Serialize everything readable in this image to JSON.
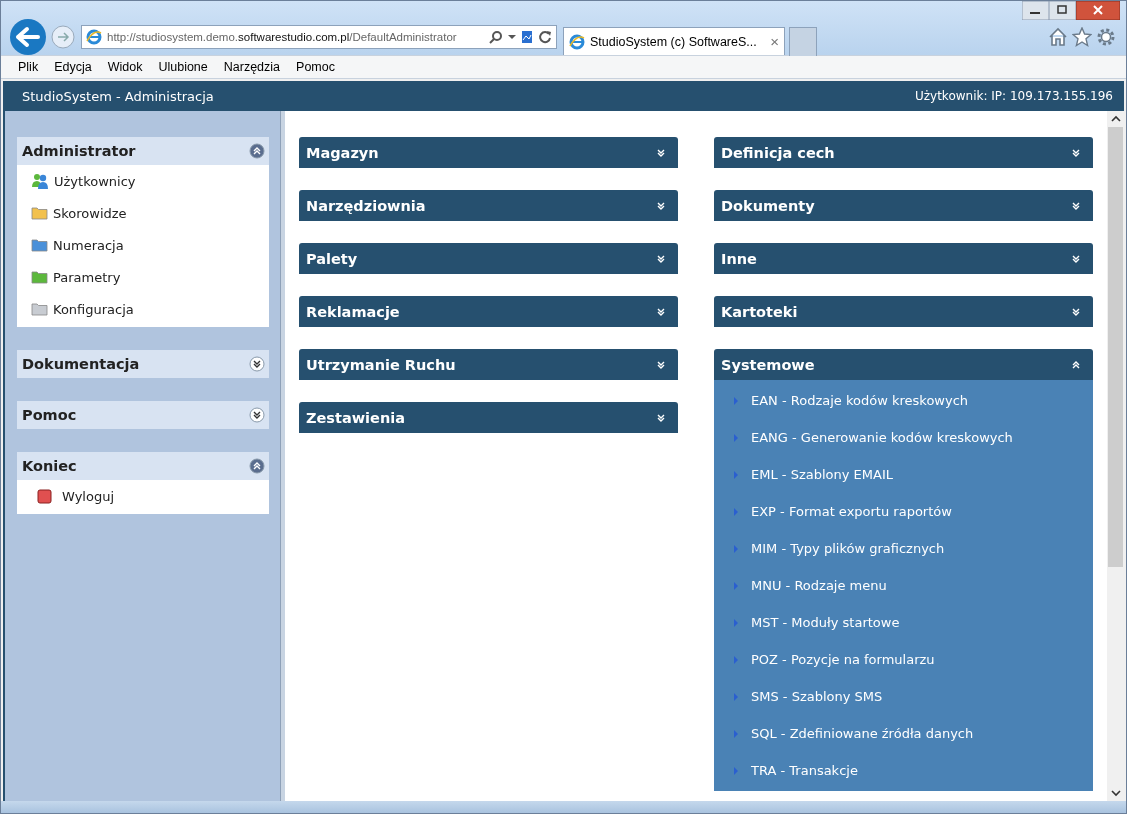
{
  "browser": {
    "address_scheme": "http://studiosystem.demo.",
    "address_host": "softwarestudio.com.pl",
    "address_path": "/DefaultAdministrator",
    "tab_title": "StudioSystem (c) SoftwareS...",
    "tab_close": "×"
  },
  "menu": [
    "Plik",
    "Edycja",
    "Widok",
    "Ulubione",
    "Narzędzia",
    "Pomoc"
  ],
  "app": {
    "title": "StudioSystem - Administracja",
    "user": "Użytkownik: IP: 109.173.155.196"
  },
  "sidebar": [
    {
      "title": "Administrator",
      "expanded": true,
      "items": [
        {
          "label": "Użytkownicy",
          "kind": "users"
        },
        {
          "label": "Skorowidze",
          "kind": "folder",
          "color": "#f2c14e"
        },
        {
          "label": "Numeracja",
          "kind": "folder",
          "color": "#4a90d9"
        },
        {
          "label": "Parametry",
          "kind": "folder",
          "color": "#5cb83c"
        },
        {
          "label": "Konfiguracja",
          "kind": "folder",
          "color": "#c8ccd2"
        }
      ]
    },
    {
      "title": "Dokumentacja",
      "expanded": false
    },
    {
      "title": "Pomoc",
      "expanded": false
    },
    {
      "title": "Koniec",
      "expanded": true,
      "items": [
        {
          "label": "Wyloguj",
          "kind": "logout"
        }
      ]
    }
  ],
  "panels_left": [
    {
      "title": "Magazyn",
      "expanded": false
    },
    {
      "title": "Narzędziownia",
      "expanded": false
    },
    {
      "title": "Palety",
      "expanded": false
    },
    {
      "title": "Reklamacje",
      "expanded": false
    },
    {
      "title": "Utrzymanie Ruchu",
      "expanded": false
    },
    {
      "title": "Zestawienia",
      "expanded": false
    }
  ],
  "panels_right": [
    {
      "title": "Definicja cech",
      "expanded": false
    },
    {
      "title": "Dokumenty",
      "expanded": false
    },
    {
      "title": "Inne",
      "expanded": false
    },
    {
      "title": "Kartoteki",
      "expanded": false
    },
    {
      "title": "Systemowe",
      "expanded": true,
      "items": [
        "EAN - Rodzaje kodów kreskowych",
        "EANG - Generowanie kodów kreskowych",
        "EML - Szablony EMAIL",
        "EXP - Format exportu raportów",
        "MIM - Typy plików graficznych",
        "MNU - Rodzaje menu",
        "MST - Moduły startowe",
        "POZ - Pozycje na formularzu",
        "SMS - Szablony SMS",
        "SQL - Zdefiniowane źródła danych",
        "TRA - Transakcje"
      ]
    }
  ]
}
